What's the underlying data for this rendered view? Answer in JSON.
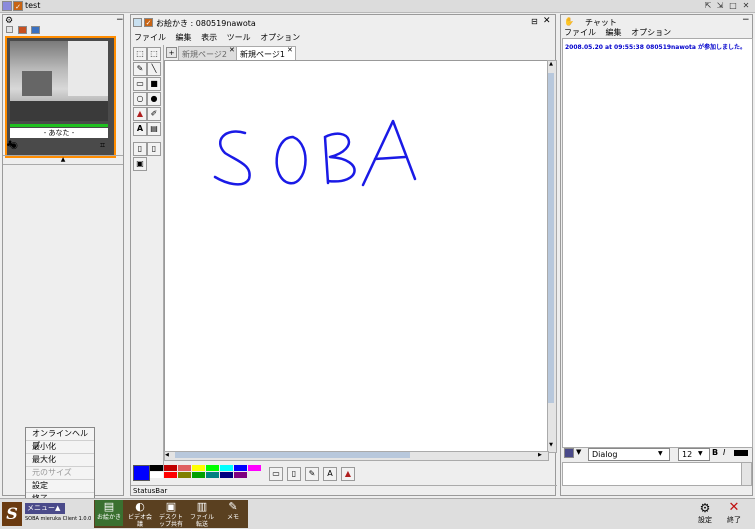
{
  "window": {
    "title": "test",
    "controls": [
      "⇱",
      "⇲",
      "□",
      "✕"
    ]
  },
  "video": {
    "user_label": "- あなた -"
  },
  "drawing": {
    "title": "お絵かき : 080519nawota",
    "menu": [
      "ファイル",
      "編集",
      "表示",
      "ツール",
      "オプション"
    ],
    "tabs": [
      {
        "label": "新規ページ2",
        "active": false
      },
      {
        "label": "新規ページ1",
        "active": true
      }
    ],
    "canvas_text": "SOBA",
    "status": "StatusBar",
    "palette": [
      "#0000ff",
      "#000000",
      "#ffffff",
      "#c00000",
      "#ff0000",
      "#e06060",
      "#808000",
      "#ffff00",
      "#00a000",
      "#00ff00",
      "#008080",
      "#00ffff",
      "#000080",
      "#0000ff",
      "#800080",
      "#ff00ff"
    ]
  },
  "chat": {
    "title": "チャット",
    "menu": [
      "ファイル",
      "編集",
      "オプション"
    ],
    "message": "2008.05.20 at 09:55:38 080519nawota が参加しました。",
    "font_name": "Dialog",
    "font_size": "12",
    "bold": "B",
    "italic": "I"
  },
  "popup_menu": {
    "items": [
      {
        "label": "オンラインヘルプ",
        "enabled": true
      },
      {
        "label": "最小化",
        "enabled": true
      },
      {
        "label": "最大化",
        "enabled": true
      },
      {
        "label": "元のサイズ",
        "enabled": false
      },
      {
        "label": "設定",
        "enabled": true
      },
      {
        "label": "終了",
        "enabled": true
      }
    ]
  },
  "taskbar": {
    "menu_button": "メニュー▲",
    "client_version": "SOBA mieruka Client 1.0.0",
    "apps": [
      "お絵かき",
      "ビデオ会議",
      "デスクトップ共有",
      "ファイル転送",
      "メモ"
    ],
    "settings": "設定",
    "exit": "終了"
  },
  "colors": {
    "accent": "#ff8c00",
    "chat_text": "#0000cc",
    "ink": "#1a1ae6"
  }
}
